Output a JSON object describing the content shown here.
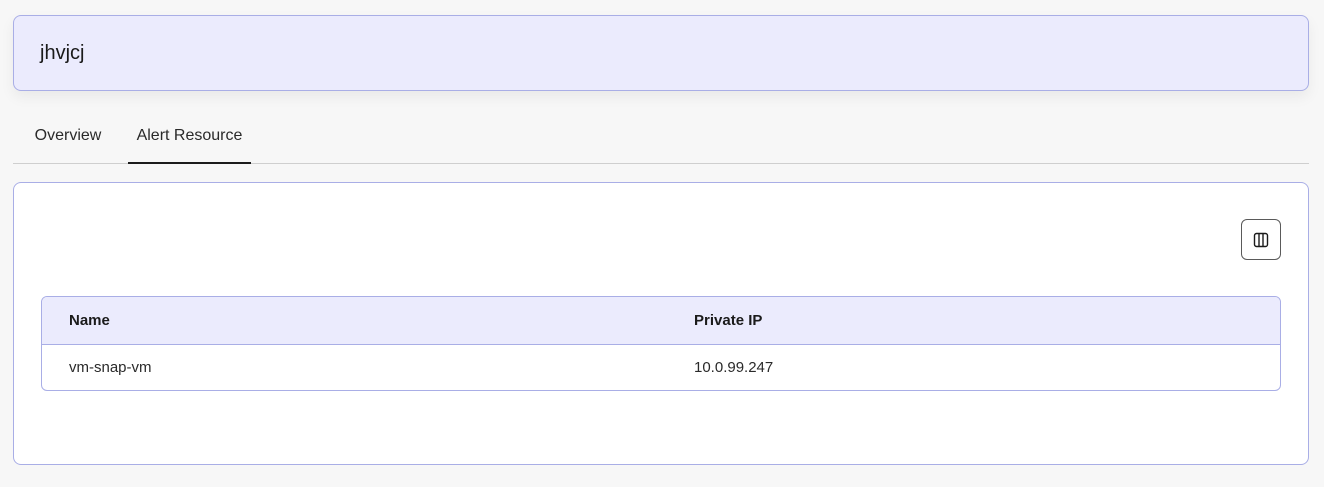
{
  "header": {
    "title": "jhvjcj"
  },
  "tabs": [
    {
      "label": "Overview",
      "active": false
    },
    {
      "label": "Alert Resource",
      "active": true
    }
  ],
  "toolbar": {
    "columns_icon": "columns-icon"
  },
  "table": {
    "columns": [
      "Name",
      "Private IP"
    ],
    "rows": [
      {
        "name": "vm-snap-vm",
        "private_ip": "10.0.99.247"
      }
    ]
  },
  "colors": {
    "accent_bg": "#ebebfd",
    "accent_border": "#a9aee6",
    "active_tab_underline": "#1b1b1b"
  }
}
